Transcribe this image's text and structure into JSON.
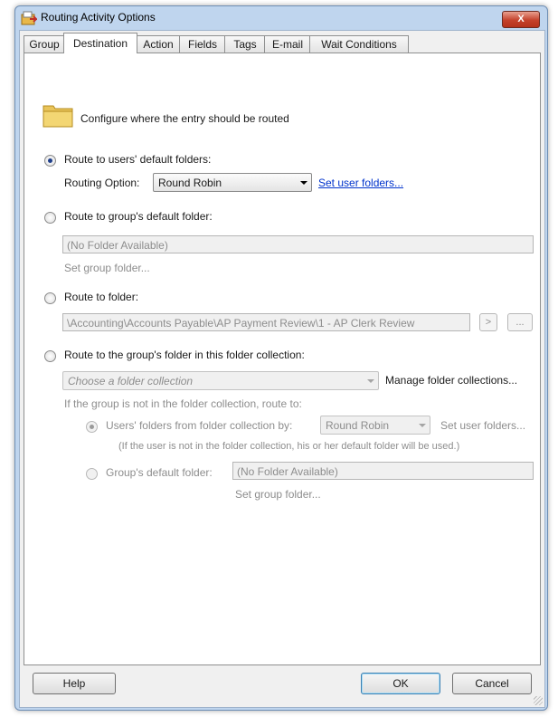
{
  "window": {
    "title": "Routing Activity Options",
    "close_label": "X"
  },
  "tabs": [
    "Group",
    "Destination",
    "Action",
    "Fields",
    "Tags",
    "E-mail",
    "Wait Conditions"
  ],
  "active_tab": "Destination",
  "intro_text": "Configure where the entry should be routed",
  "option_users": {
    "label": "Route to users' default folders:",
    "routing_option_label": "Routing Option:",
    "routing_option_value": "Round Robin",
    "link": "Set user folders..."
  },
  "option_group": {
    "label": "Route to group's default folder:",
    "field_value": "(No Folder Available)",
    "set_label": "Set group folder..."
  },
  "option_folder": {
    "label": "Route to folder:",
    "path": "\\Accounting\\Accounts Payable\\AP Payment Review\\1 - AP Clerk Review",
    "btn_next": ">",
    "btn_browse": "..."
  },
  "option_collection": {
    "label": "Route to the group's folder in this folder collection:",
    "placeholder": "Choose a folder collection",
    "manage_label": "Manage folder collections...",
    "fallback_text": "If the group is not in the folder collection, route to:",
    "sub_users_label": "Users' folders from folder collection by:",
    "sub_users_value": "Round Robin",
    "sub_users_link": "Set user folders...",
    "note": "(If the user is not in the folder collection, his or her default folder will be used.)",
    "sub_group_label": "Group's default folder:",
    "sub_group_value": "(No Folder Available)",
    "sub_group_set": "Set group folder..."
  },
  "buttons": {
    "help": "Help",
    "ok": "OK",
    "cancel": "Cancel"
  }
}
